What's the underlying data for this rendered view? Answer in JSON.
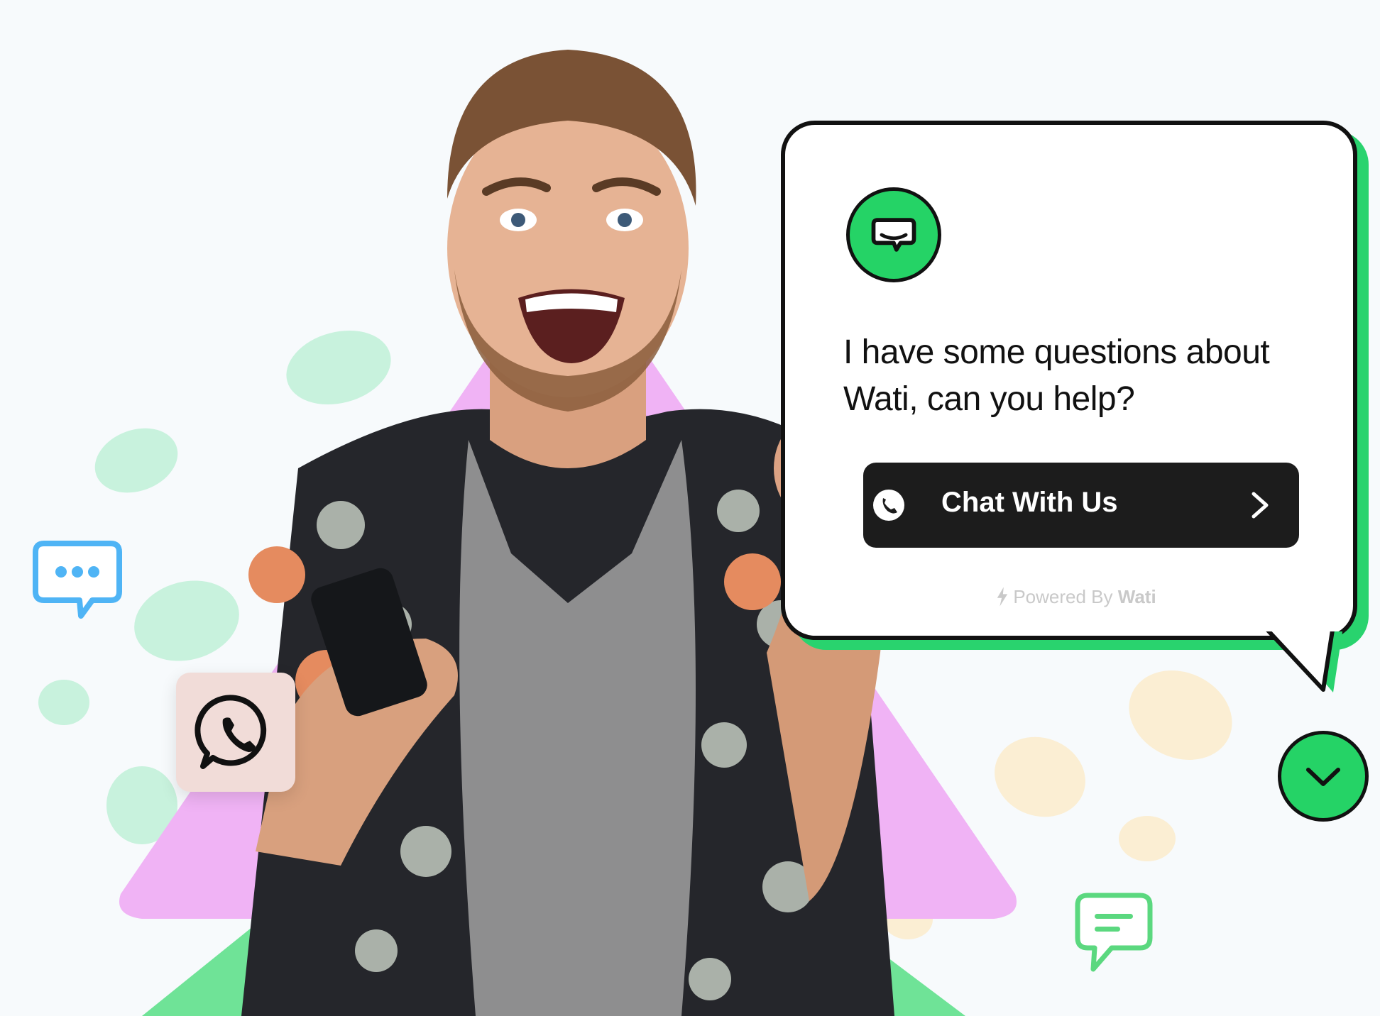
{
  "widget": {
    "question_line1": "I have some questions about",
    "question_line2": "Wati, can you help?",
    "button_label": "Chat With Us",
    "powered_prefix": "Powered By",
    "powered_brand": "Wati"
  },
  "icons": {
    "logo": "chat-bubble-icon",
    "button_leading": "whatsapp-phone-icon",
    "button_trailing": "chevron-right-icon",
    "powered": "lightning-icon",
    "collapse": "chevron-down-icon",
    "tile": "whatsapp-icon",
    "decor_left": "chat-dots-icon",
    "decor_right": "chat-lines-icon"
  },
  "colors": {
    "brand_green": "#25d366",
    "card_border": "#111111",
    "button_bg": "#1c1c1c",
    "triangle_pink": "#f0b3f5",
    "triangle_green": "#6fe397",
    "decor_blue": "#4fb4f5"
  }
}
